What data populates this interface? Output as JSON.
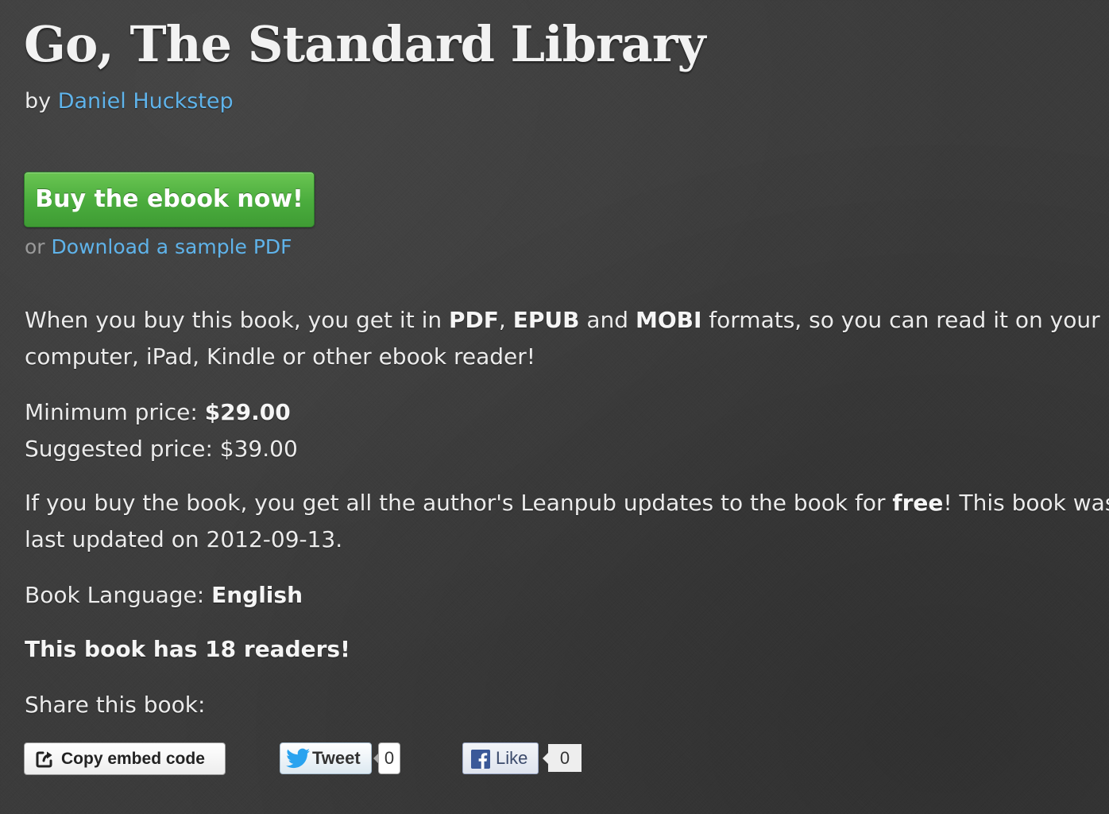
{
  "book": {
    "title": "Go, The Standard Library",
    "by_prefix": "by",
    "author": "Daniel Huckstep"
  },
  "purchase": {
    "buy_button": "Buy the ebook now!",
    "or_text": "or",
    "sample_link": "Download a sample PDF",
    "button_color": "#4aac3d",
    "link_color": "#5fb3ea"
  },
  "formats": {
    "intro": "When you buy this book, you get it in",
    "format1": "PDF",
    "sep1": ",",
    "format2": "EPUB",
    "and_word": "and",
    "format3": "MOBI",
    "line1_end": "formats, so you can read it on your",
    "line2": "computer, iPad, Kindle or other ebook reader!"
  },
  "pricing": {
    "minimum_label": "Minimum price:",
    "minimum_value": "$29.00",
    "suggested_label": "Suggested price:",
    "suggested_value": "$39.00"
  },
  "updates": {
    "line1_start": "If you buy the book, you get all the author's Leanpub updates to the book for",
    "free_word": "free",
    "line1_end": "! This book was",
    "line2": "last updated on 2012-09-13."
  },
  "language": {
    "label": "Book Language:",
    "value": "English"
  },
  "readers_text": "This book has 18 readers!",
  "share": {
    "heading": "Share this book:",
    "embed_button": "Copy embed code",
    "tweet_button": "Tweet",
    "tweet_count": "0",
    "like_button": "Like",
    "like_count": "0",
    "icons": {
      "embed": "share-arrow-icon",
      "twitter": "twitter-bird-icon",
      "facebook": "facebook-icon"
    }
  }
}
